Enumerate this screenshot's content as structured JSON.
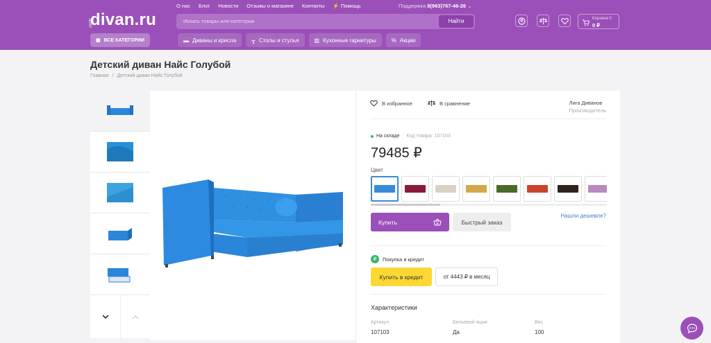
{
  "header": {
    "top_links": [
      "О нас",
      "Блог",
      "Новости",
      "Отзывы о магазине",
      "Контакты",
      "Помощь"
    ],
    "support_label": "Поддержка",
    "support_phone": "8(963)767-46-26",
    "logo_prefix": "centr",
    "logo": "divan.ru",
    "search_placeholder": "Искать товары или категории",
    "search_button": "Найти",
    "cart_label": "Корзина 0",
    "cart_sum": "0 ₽",
    "all_categories": "ВСЕ КАТЕГОРИИ",
    "nav": [
      "Диваны и кресла",
      "Столы и стулья",
      "Кухонные гарнитуры",
      "Акции"
    ]
  },
  "page": {
    "title": "Детский диван Найс Голубой",
    "breadcrumbs": [
      "Главная",
      "Детский диван Найс Голубой"
    ]
  },
  "product": {
    "favorite": "В избранное",
    "compare": "В сравнение",
    "maker": "Лига Диванов",
    "maker_sub": "Производитель",
    "stock": "На складе",
    "code": "Код товара: 107103",
    "price": "79485 ₽",
    "color_label": "Цвет",
    "swatch_colors": [
      "#3a8ad8",
      "#8a1a3a",
      "#d9d2c4",
      "#d4a84a",
      "#4a6a2a",
      "#c8442e",
      "#2e241e",
      "#b88ac0"
    ],
    "buy": "Купить",
    "quick_order": "Быстрый заказ",
    "cheaper": "Нашли дешевле?",
    "credit_label": "Покупка в кредит",
    "credit_button": "Купить в кредит",
    "monthly": "от 4443 ₽ в месяц",
    "characteristics_title": "Характеристики",
    "characteristics": [
      {
        "key": "Артикул",
        "value": "107103"
      },
      {
        "key": "Бельевой ящик",
        "value": "Да"
      },
      {
        "key": "Вес",
        "value": "100"
      }
    ]
  },
  "colors": {
    "brand": "#9b4fb8",
    "accent_yellow": "#fdd835",
    "sofa_blue": "#2b86d9"
  }
}
